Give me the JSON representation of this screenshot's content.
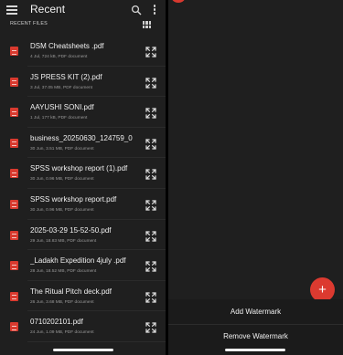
{
  "left_pane": {
    "title": "Recent",
    "section_label": "RECENT FILES",
    "icons": {
      "menu": "hamburger-menu-icon",
      "search": "search-icon",
      "more": "more-vert-icon",
      "grid": "grid-view-icon",
      "file": "pdf-file-icon",
      "expand": "expand-icon"
    },
    "files": [
      {
        "name": "DSM Cheatsheets .pdf",
        "meta": "4 Jul, 724 kB, PDF document"
      },
      {
        "name": "JS PRESS KIT (2).pdf",
        "meta": "3 Jul, 37.05 MB, PDF document"
      },
      {
        "name": "AAYUSHI SONI.pdf",
        "meta": "1 Jul, 177 kB, PDF document"
      },
      {
        "name": "business_20250630_124759_0...",
        "meta": "30 Jun, 3.51 MB, PDF document"
      },
      {
        "name": "SPSS workshop report (1).pdf",
        "meta": "30 Jun, 0.96 MB, PDF document"
      },
      {
        "name": "SPSS workshop report.pdf",
        "meta": "30 Jun, 0.96 MB, PDF document"
      },
      {
        "name": "2025-03-29 15-52-50.pdf",
        "meta": "29 Jun, 18.83 MB, PDF document"
      },
      {
        "name": "_Ladakh Expedition 4july .pdf",
        "meta": "28 Jun, 18.52 MB, PDF document"
      },
      {
        "name": "The Ritual Pitch deck.pdf",
        "meta": "26 Jun, 3.68 MB, PDF document"
      },
      {
        "name": "0710202101.pdf",
        "meta": "24 Jun, 1.09 MB, PDF document"
      }
    ]
  },
  "right_pane": {
    "fab_label": "+",
    "fab_icon": "plus-icon",
    "sheet": {
      "add_watermark": "Add Watermark",
      "remove_watermark": "Remove Watermark"
    }
  },
  "colors": {
    "background": "#1f1f1f",
    "accent": "#dc3a30",
    "text": "#f0f0f0",
    "muted": "#9a9a9a"
  }
}
